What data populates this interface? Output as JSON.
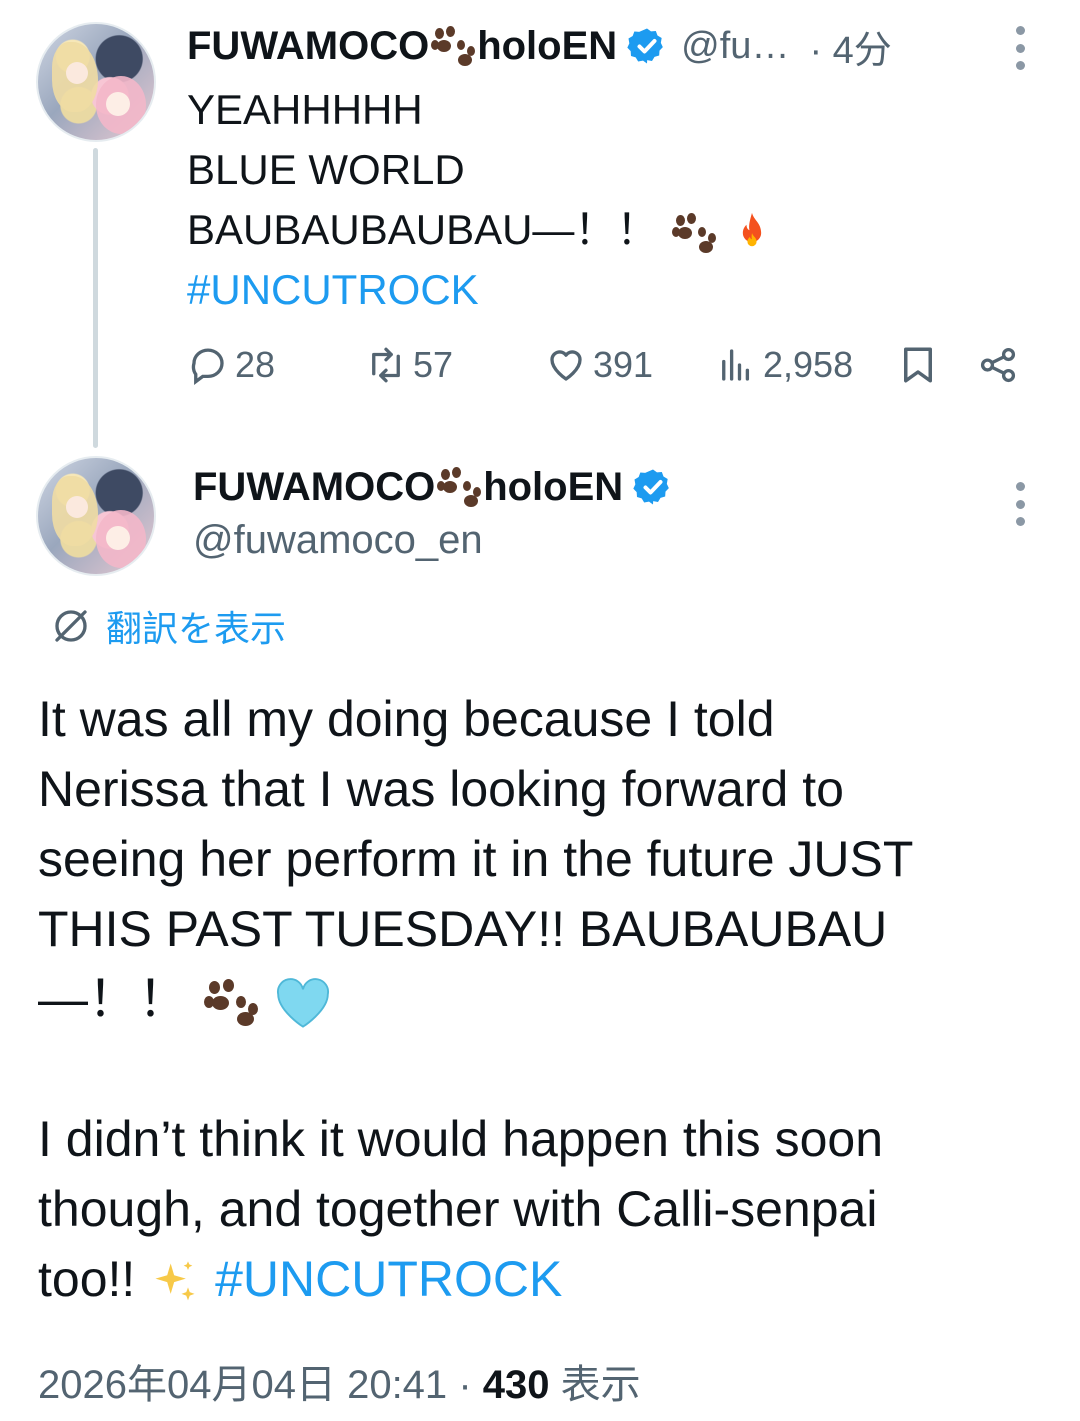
{
  "colors": {
    "accent": "#1d9bf0",
    "text_primary": "#0f1419",
    "text_secondary": "#536471",
    "thread_line": "#cfd9de"
  },
  "reply_tweet": {
    "display_name_left": "FUWAMOCO",
    "paw_icon": "paw-prints-emoji",
    "display_name_right": "holoEN",
    "verified_icon": "verified-badge-icon",
    "handle": "@fu…",
    "time": "· 4分",
    "lines": [
      "YEAHHHHH",
      "BLUE WORLD",
      "BAUBAUBAUBAU—！！"
    ],
    "hashtag": "#UNCUTROCK",
    "actions": {
      "replies": "28",
      "retweets": "57",
      "likes": "391",
      "views": "2,958"
    }
  },
  "main_tweet": {
    "display_name_left": "FUWAMOCO",
    "display_name_right": "holoEN",
    "handle": "@fuwamoco_en",
    "translate_label": "翻訳を表示",
    "paragraph1_lines": [
      "It was all my doing because I told",
      "Nerissa that I was looking forward to",
      "seeing her perform it in the future JUST",
      "THIS PAST TUESDAY!! BAUBAUBAU",
      "—！！"
    ],
    "paragraph2_lines": [
      "I didn’t think it would happen this soon",
      "though, and together with Calli-senpai",
      "too!!"
    ],
    "hashtag": "#UNCUTROCK",
    "timestamp": "2026年04月04日 20:41",
    "separator": "·",
    "view_count": "430",
    "view_label": "表示"
  }
}
